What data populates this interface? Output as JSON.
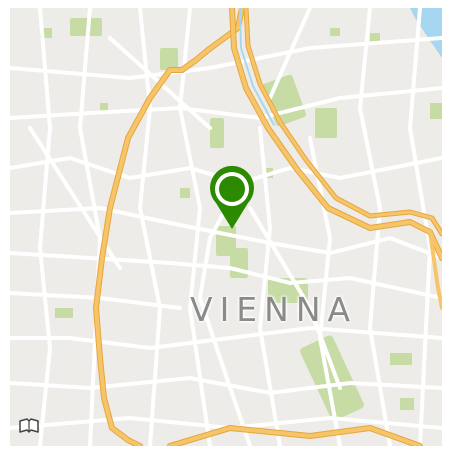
{
  "map": {
    "city_label": "VIENNA",
    "pin": {
      "icon": "location-pin-icon",
      "color": "#2b8a00"
    },
    "controls": {
      "map_style_icon": "map-book-icon"
    },
    "colors": {
      "land": "#eeece8",
      "park": "#c6dca4",
      "water": "#a7d7f0",
      "road": "#ffffff",
      "highway": "#f4b94e",
      "highway_casing": "#e6a63c"
    }
  }
}
